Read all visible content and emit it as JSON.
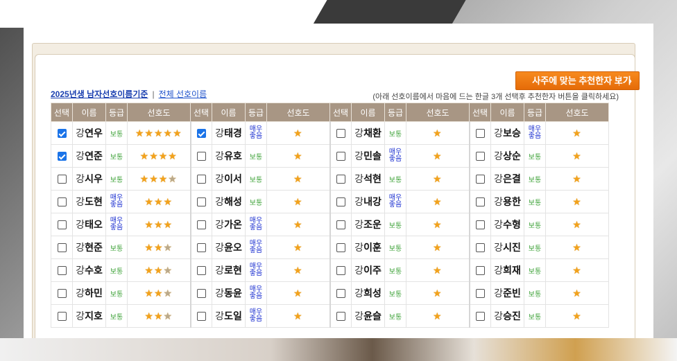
{
  "header": {
    "link_primary": "2025년생 남자선호이름기준",
    "separator": "|",
    "link_secondary": "전체 선호이름",
    "recommend_button": "사주에 맞는 추천한자 보기",
    "hint": "(아래 선호이름에서 마음에 드는 한글 3개 선택후 추천한자 버튼을 클릭하세요)"
  },
  "columns": [
    "선택",
    "이름",
    "등급",
    "선호도"
  ],
  "column_groups": 4,
  "grade_labels": {
    "normal": "보통",
    "very_good": "매우 좋음"
  },
  "star_glyph": "★",
  "colors": {
    "header_bg": "#a89684",
    "button_bg": "#f07a12",
    "grade_normal": "#3fa33a",
    "grade_very_good": "#1b2fd0",
    "star": "#f3a21b"
  },
  "rows": [
    [
      {
        "checked": true,
        "surname": "강",
        "given": "연우",
        "grade": "보통",
        "stars": 5
      },
      {
        "checked": true,
        "surname": "강",
        "given": "태경",
        "grade": "매우 좋음",
        "stars": 1
      },
      {
        "checked": false,
        "surname": "강",
        "given": "채환",
        "grade": "보통",
        "stars": 1
      },
      {
        "checked": false,
        "surname": "강",
        "given": "보승",
        "grade": "매우 좋음",
        "stars": 1
      }
    ],
    [
      {
        "checked": true,
        "surname": "강",
        "given": "연준",
        "grade": "보통",
        "stars": 4
      },
      {
        "checked": false,
        "surname": "강",
        "given": "유호",
        "grade": "보통",
        "stars": 1
      },
      {
        "checked": false,
        "surname": "강",
        "given": "민솔",
        "grade": "매우 좋음",
        "stars": 1
      },
      {
        "checked": false,
        "surname": "강",
        "given": "상순",
        "grade": "보통",
        "stars": 1
      }
    ],
    [
      {
        "checked": false,
        "surname": "강",
        "given": "시우",
        "grade": "보통",
        "stars": 3.5
      },
      {
        "checked": false,
        "surname": "강",
        "given": "이서",
        "grade": "보통",
        "stars": 1
      },
      {
        "checked": false,
        "surname": "강",
        "given": "석현",
        "grade": "보통",
        "stars": 1
      },
      {
        "checked": false,
        "surname": "강",
        "given": "은결",
        "grade": "보통",
        "stars": 1
      }
    ],
    [
      {
        "checked": false,
        "surname": "강",
        "given": "도현",
        "grade": "매우 좋음",
        "stars": 3
      },
      {
        "checked": false,
        "surname": "강",
        "given": "해성",
        "grade": "보통",
        "stars": 1
      },
      {
        "checked": false,
        "surname": "강",
        "given": "내강",
        "grade": "매우 좋음",
        "stars": 1
      },
      {
        "checked": false,
        "surname": "강",
        "given": "용한",
        "grade": "보통",
        "stars": 1
      }
    ],
    [
      {
        "checked": false,
        "surname": "강",
        "given": "태오",
        "grade": "매우 좋음",
        "stars": 3
      },
      {
        "checked": false,
        "surname": "강",
        "given": "가온",
        "grade": "매우 좋음",
        "stars": 1
      },
      {
        "checked": false,
        "surname": "강",
        "given": "조운",
        "grade": "보통",
        "stars": 1
      },
      {
        "checked": false,
        "surname": "강",
        "given": "수형",
        "grade": "보통",
        "stars": 1
      }
    ],
    [
      {
        "checked": false,
        "surname": "강",
        "given": "현준",
        "grade": "보통",
        "stars": 2.5
      },
      {
        "checked": false,
        "surname": "강",
        "given": "윤오",
        "grade": "매우 좋음",
        "stars": 1
      },
      {
        "checked": false,
        "surname": "강",
        "given": "이훈",
        "grade": "보통",
        "stars": 1
      },
      {
        "checked": false,
        "surname": "강",
        "given": "시진",
        "grade": "보통",
        "stars": 1
      }
    ],
    [
      {
        "checked": false,
        "surname": "강",
        "given": "수호",
        "grade": "보통",
        "stars": 2.5
      },
      {
        "checked": false,
        "surname": "강",
        "given": "로현",
        "grade": "매우 좋음",
        "stars": 1
      },
      {
        "checked": false,
        "surname": "강",
        "given": "이주",
        "grade": "보통",
        "stars": 1
      },
      {
        "checked": false,
        "surname": "강",
        "given": "희재",
        "grade": "보통",
        "stars": 1
      }
    ],
    [
      {
        "checked": false,
        "surname": "강",
        "given": "하민",
        "grade": "보통",
        "stars": 2.5
      },
      {
        "checked": false,
        "surname": "강",
        "given": "동윤",
        "grade": "매우 좋음",
        "stars": 1
      },
      {
        "checked": false,
        "surname": "강",
        "given": "희성",
        "grade": "보통",
        "stars": 1
      },
      {
        "checked": false,
        "surname": "강",
        "given": "준빈",
        "grade": "보통",
        "stars": 1
      }
    ],
    [
      {
        "checked": false,
        "surname": "강",
        "given": "지호",
        "grade": "보통",
        "stars": 2.5
      },
      {
        "checked": false,
        "surname": "강",
        "given": "도일",
        "grade": "매우 좋음",
        "stars": 1
      },
      {
        "checked": false,
        "surname": "강",
        "given": "윤슬",
        "grade": "보통",
        "stars": 1
      },
      {
        "checked": false,
        "surname": "강",
        "given": "승진",
        "grade": "보통",
        "stars": 1
      }
    ]
  ]
}
